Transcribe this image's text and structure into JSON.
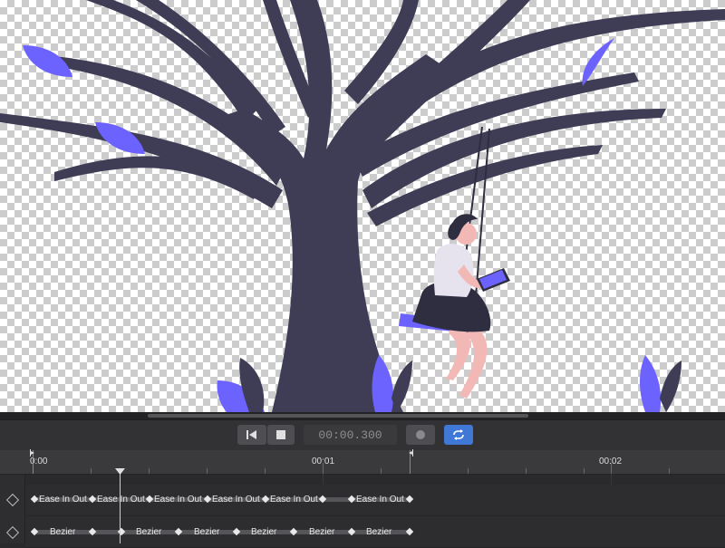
{
  "transport": {
    "timecode": "00:00.300"
  },
  "ruler": {
    "labels": [
      "0:00",
      "00:01",
      "00:02"
    ]
  },
  "tracks": {
    "easing": [
      "Ease In Out",
      "Ease In Out",
      "Ease In Out",
      "Ease In Out",
      "Ease In Out",
      "Ease In Out"
    ],
    "bezier": [
      "Bezier",
      "Bezier",
      "Bezier",
      "Bezier",
      "Bezier",
      "Bezier"
    ]
  },
  "colors": {
    "tree": "#3f3d56",
    "leaf": "#6c63ff",
    "skin": "#f2b8b5",
    "accent_button": "#3f78d6"
  }
}
